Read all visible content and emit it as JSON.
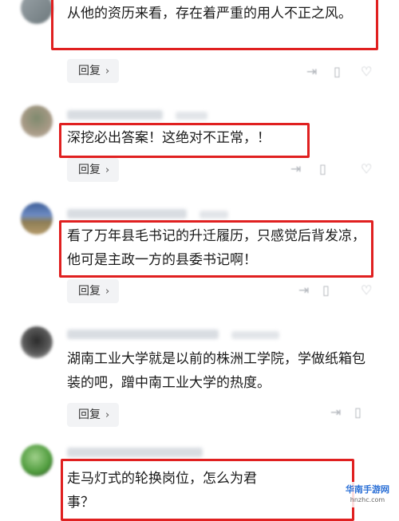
{
  "reply_label": "回复",
  "reply_chevron": "›",
  "comments": [
    {
      "text": "从他的资历来看，存在着严重的用人不正之风。"
    },
    {
      "text": "深挖必出答案！这绝对不正常，！"
    },
    {
      "text": "看了万年县毛书记的升迁履历，只感觉后背发凉，他可是主政一方的县委书记啊！"
    },
    {
      "text": "湖南工业大学就是以前的株洲工学院，学做纸箱包装的吧，蹭中南工业大学的热度。"
    },
    {
      "text": "走马灯式的轮换岗位，怎么为君\n事？"
    }
  ],
  "icons": [
    "share-icon",
    "comment-icon",
    "like-icon"
  ],
  "watermark": {
    "title": "华南手游网",
    "subtitle": "hnzhc.com"
  },
  "colors": {
    "highlight": "#e02020",
    "reply_bg": "#f2f3f5"
  }
}
